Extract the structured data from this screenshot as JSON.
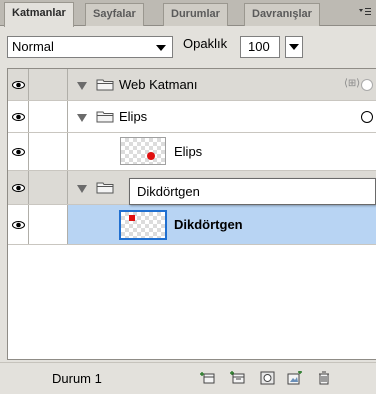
{
  "tabs": [
    {
      "label": "Katmanlar",
      "active": true
    },
    {
      "label": "Sayfalar",
      "active": false
    },
    {
      "label": "Durumlar",
      "active": false
    },
    {
      "label": "Davranışlar",
      "active": false
    }
  ],
  "panel_menu_icon": "panel-menu-icon",
  "toolbar": {
    "blend_mode": "Normal",
    "opacity_label": "Opaklık",
    "opacity_value": "100"
  },
  "layers": [
    {
      "type": "folder",
      "label": "Web Katmanı",
      "expanded": true,
      "visible": true
    },
    {
      "type": "folder",
      "label": "Elips",
      "expanded": true,
      "visible": true
    },
    {
      "type": "object",
      "label": "Elips",
      "visible": true,
      "shape": "circle"
    },
    {
      "type": "folder",
      "label": "",
      "expanded": true,
      "visible": true,
      "renaming": true
    },
    {
      "type": "object",
      "label": "Dikdörtgen",
      "visible": true,
      "shape": "square",
      "selected": true
    }
  ],
  "rename_field": {
    "value": "Dikdörtgen"
  },
  "status": {
    "state_label": "Durum 1"
  },
  "colors": {
    "selection": "#b8d4f3",
    "accent": "#1f6fd0",
    "shape_fill": "#e01010"
  }
}
